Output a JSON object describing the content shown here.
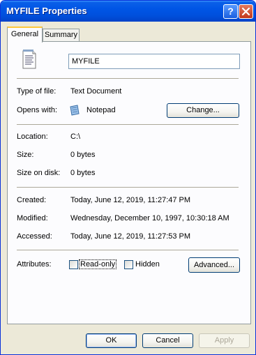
{
  "window": {
    "title": "MYFILE Properties"
  },
  "titlebar": {
    "help_label": "?",
    "close_label": "close"
  },
  "tabs": [
    {
      "label": "General",
      "selected": true
    },
    {
      "label": "Summary",
      "selected": false
    }
  ],
  "general": {
    "file_name": "MYFILE",
    "type_label": "Type of file:",
    "type_value": "Text Document",
    "opens_label": "Opens with:",
    "opens_value": "Notepad",
    "change_button": "Change...",
    "location_label": "Location:",
    "location_value": "C:\\",
    "size_label": "Size:",
    "size_value": "0 bytes",
    "size_on_disk_label": "Size on disk:",
    "size_on_disk_value": "0 bytes",
    "created_label": "Created:",
    "created_value": "Today, June 12, 2019, 11:27:47 PM",
    "modified_label": "Modified:",
    "modified_value": "Wednesday, December 10, 1997, 10:30:18 AM",
    "accessed_label": "Accessed:",
    "accessed_value": "Today, June 12, 2019, 11:27:53 PM",
    "attributes_label": "Attributes:",
    "readonly_label": "Read-only",
    "readonly_checked": false,
    "hidden_label": "Hidden",
    "hidden_checked": false,
    "advanced_button": "Advanced..."
  },
  "buttons": {
    "ok": "OK",
    "cancel": "Cancel",
    "apply": "Apply"
  },
  "icons": {
    "file": "text-document-icon",
    "program": "notepad-icon"
  },
  "colors": {
    "titlebar": "#0055e5",
    "dialog_bg": "#ece9d8",
    "close": "#c1381c"
  }
}
